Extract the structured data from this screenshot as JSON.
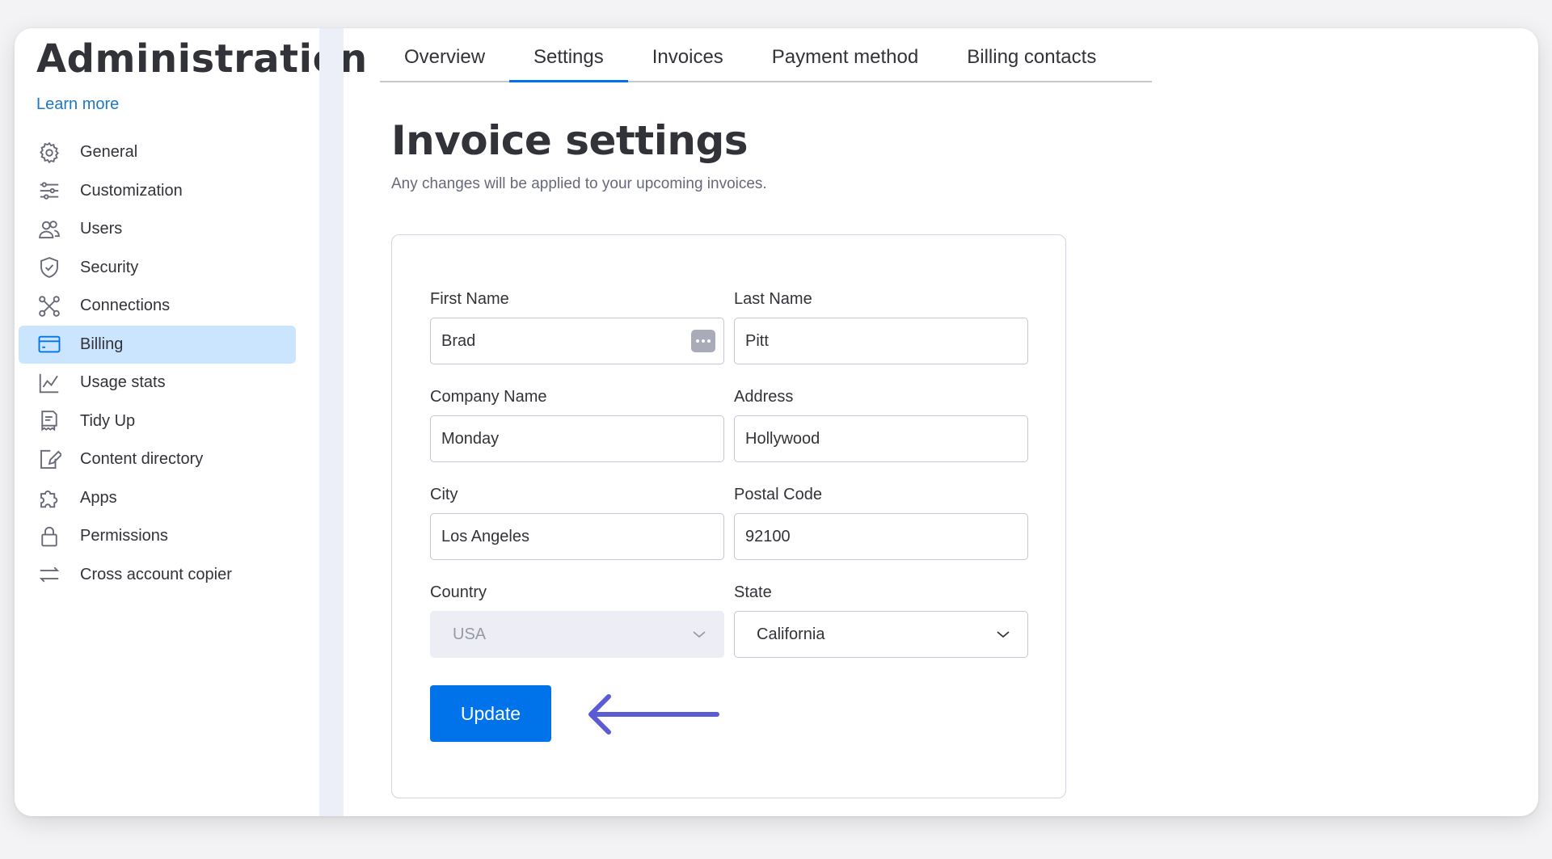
{
  "sidebar": {
    "title": "Administration",
    "learn_more": "Learn more",
    "items": [
      {
        "label": "General",
        "icon": "gear-icon"
      },
      {
        "label": "Customization",
        "icon": "sliders-icon"
      },
      {
        "label": "Users",
        "icon": "users-icon"
      },
      {
        "label": "Security",
        "icon": "shield-icon"
      },
      {
        "label": "Connections",
        "icon": "connections-icon"
      },
      {
        "label": "Billing",
        "icon": "credit-card-icon",
        "active": true
      },
      {
        "label": "Usage stats",
        "icon": "chart-icon"
      },
      {
        "label": "Tidy Up",
        "icon": "receipt-icon"
      },
      {
        "label": "Content directory",
        "icon": "edit-document-icon"
      },
      {
        "label": "Apps",
        "icon": "puzzle-icon"
      },
      {
        "label": "Permissions",
        "icon": "lock-icon"
      },
      {
        "label": "Cross account copier",
        "icon": "arrows-swap-icon"
      }
    ]
  },
  "tabs": [
    {
      "label": "Overview"
    },
    {
      "label": "Settings",
      "active": true
    },
    {
      "label": "Invoices"
    },
    {
      "label": "Payment method"
    },
    {
      "label": "Billing contacts"
    }
  ],
  "main": {
    "title": "Invoice settings",
    "subtitle": "Any changes will be applied to your upcoming invoices."
  },
  "form": {
    "first_name": {
      "label": "First Name",
      "value": "Brad"
    },
    "last_name": {
      "label": "Last Name",
      "value": "Pitt"
    },
    "company": {
      "label": "Company Name",
      "value": "Monday"
    },
    "address": {
      "label": "Address",
      "value": "Hollywood"
    },
    "city": {
      "label": "City",
      "value": "Los Angeles"
    },
    "postal": {
      "label": "Postal Code",
      "value": "92100"
    },
    "country": {
      "label": "Country",
      "value": "USA",
      "disabled": true
    },
    "state": {
      "label": "State",
      "value": "California"
    },
    "update_label": "Update"
  },
  "colors": {
    "accent": "#0073ea",
    "active_nav_bg": "#cce5ff",
    "arrow": "#5b5bd6",
    "link": "#1f76c2"
  }
}
